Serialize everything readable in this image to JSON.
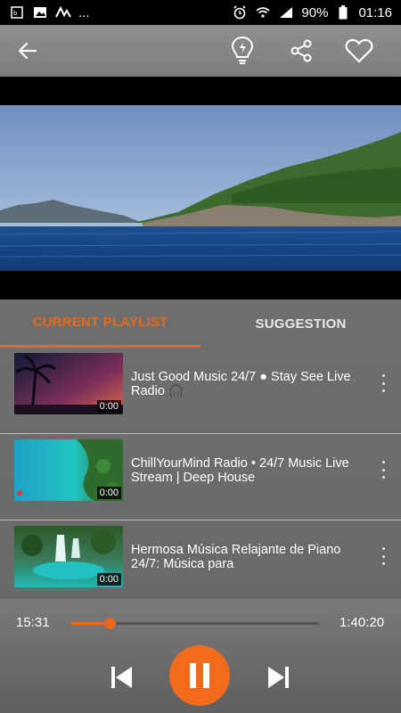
{
  "status_bar": {
    "left_text": "...",
    "battery": "90%",
    "time": "01:16"
  },
  "toolbar": {
    "back_icon": "back-arrow-icon",
    "icons": [
      "lightbulb-icon",
      "share-icon",
      "heart-icon"
    ]
  },
  "tabs": [
    {
      "label": "CURRENT PLAYLIST",
      "active": true
    },
    {
      "label": "SUGGESTION",
      "active": false
    }
  ],
  "playlist": [
    {
      "title": "Just Good Music 24/7 ● Stay See Live Radio 🎧",
      "duration": "0:00"
    },
    {
      "title": "ChillYourMind Radio • 24/7 Music Live Stream | Deep House",
      "duration": "0:00"
    },
    {
      "title": "Hermosa Música Relajante de Piano 24/7: Música para",
      "duration": "0:00"
    }
  ],
  "player": {
    "elapsed": "15:31",
    "total": "1:40:20",
    "progress": 0.155
  },
  "colors": {
    "accent": "#e8691b"
  }
}
